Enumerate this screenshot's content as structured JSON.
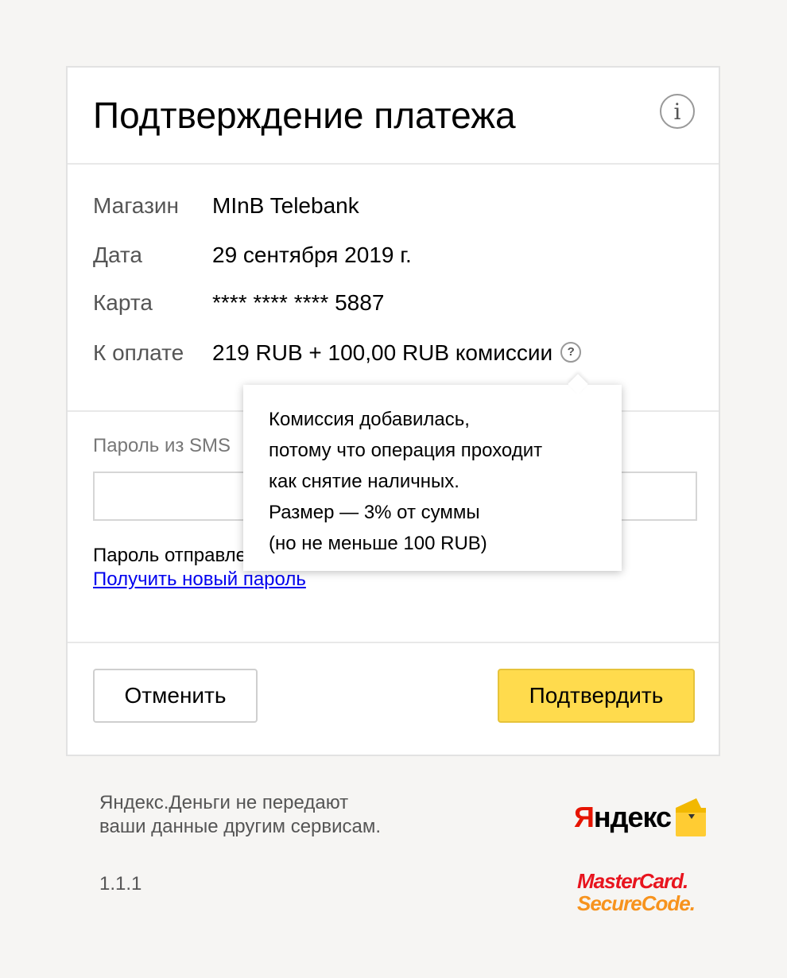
{
  "page": {
    "title": "Подтверждение платежа",
    "info_icon": "info-icon"
  },
  "details": {
    "shop_label": "Магазин",
    "shop_value": "MInB Telebank",
    "date_label": "Дата",
    "date_value": "29 сентября 2019 г.",
    "card_label": "Карта",
    "card_value": "**** **** **** 5887",
    "amount_label": "К оплате",
    "amount_value": "219 RUB + 100,00 RUB комиссии",
    "help_icon": "?"
  },
  "sms": {
    "label": "Пароль из SMS",
    "input_value": "",
    "sent_text": "Пароль отправлен",
    "new_password_link": "Получить новый пароль"
  },
  "tooltip": {
    "lines": [
      "Комиссия добавилась,",
      "потому что операция проходит",
      "как снятие наличных.",
      "Размер — 3% от суммы",
      "(но не меньше 100 RUB)"
    ]
  },
  "buttons": {
    "cancel": "Отменить",
    "confirm": "Подтвердить"
  },
  "footer": {
    "privacy_line1": "Яндекс.Деньги не передают",
    "privacy_line2": "ваши данные другим сервисам.",
    "version": "1.1.1",
    "yandex_logo_text_red": "Я",
    "yandex_logo_text_black": "ндекс",
    "mastercard_line1": "MasterCard.",
    "mastercard_line2": "SecureCode."
  },
  "colors": {
    "confirm_button": "#ffdb4d",
    "link": "#0000ee",
    "yandex_red": "#e61400",
    "mastercard_red": "#e8141e",
    "mastercard_orange": "#f7931e"
  }
}
